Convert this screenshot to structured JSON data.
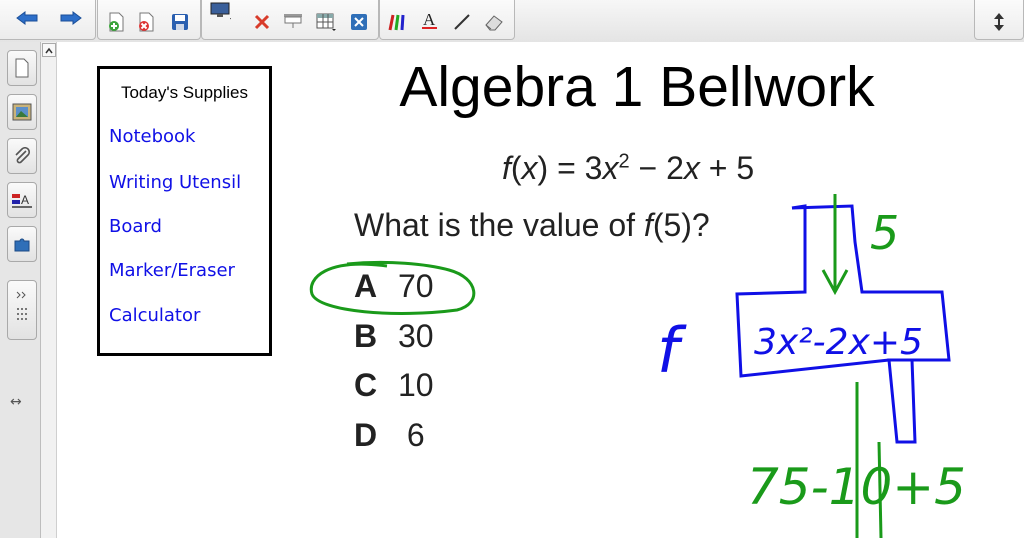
{
  "toolbar": {
    "icons": [
      "back-arrow-icon",
      "forward-arrow-icon",
      "add-page-icon",
      "delete-page-icon",
      "save-icon",
      "screen-capture-icon",
      "delete-icon",
      "screen-shade-icon",
      "table-icon",
      "fit-page-icon",
      "pens-icon",
      "text-icon",
      "line-icon",
      "eraser-icon",
      "move-toolbar-icon"
    ]
  },
  "sidebar": {
    "tabs": [
      "page-sorter-icon",
      "gallery-icon",
      "attachments-icon",
      "properties-icon",
      "addons-icon"
    ]
  },
  "slide": {
    "supplies": {
      "heading": "Today's Supplies",
      "items": [
        "Notebook",
        "Writing Utensil",
        "Board",
        "Marker/Eraser",
        "Calculator"
      ]
    },
    "title": "Algebra 1 Bellwork",
    "equation": {
      "f": "f",
      "x": "x",
      "mid": ") = 3",
      "x2": "x",
      "exp": "2",
      "minus": " − 2",
      "x3": "x",
      "tail": " + 5"
    },
    "question": {
      "pre": "What is the value of ",
      "f": "f",
      "post": "(5)?"
    },
    "answers": [
      {
        "letter": "A",
        "value": "70"
      },
      {
        "letter": "B",
        "value": "30"
      },
      {
        "letter": "C",
        "value": "10"
      },
      {
        "letter": "D",
        "value": "6"
      }
    ],
    "ink": {
      "input": "5",
      "function_label": "f",
      "rule": "3x²-2x+5",
      "work": "75-10+5"
    }
  },
  "colors": {
    "ink_blue": "#1010e6",
    "ink_green": "#1a9a1a"
  }
}
